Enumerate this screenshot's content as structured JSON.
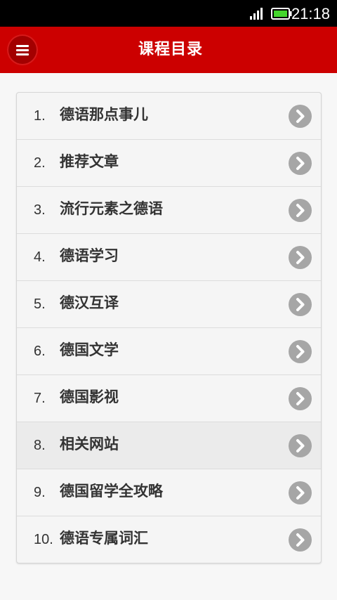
{
  "status_bar": {
    "time": "21:18",
    "signal_icon": "signal-bars-icon",
    "battery_icon": "battery-icon"
  },
  "app_bar": {
    "title": "课程目录",
    "menu_icon": "hamburger-menu-icon",
    "color": "#cc0000"
  },
  "list": [
    {
      "number": "1.",
      "label": "德语那点事儿"
    },
    {
      "number": "2.",
      "label": "推荐文章"
    },
    {
      "number": "3.",
      "label": "流行元素之德语"
    },
    {
      "number": "4.",
      "label": "德语学习"
    },
    {
      "number": "5.",
      "label": "德汉互译"
    },
    {
      "number": "6.",
      "label": "德国文学"
    },
    {
      "number": "7.",
      "label": "德国影视"
    },
    {
      "number": "8.",
      "label": "相关网站"
    },
    {
      "number": "9.",
      "label": "德国留学全攻略"
    },
    {
      "number": "10.",
      "label": "德语专属词汇"
    }
  ],
  "chevron_icon": "chevron-right-circle-icon",
  "chevron_color": "#a6a6a6"
}
